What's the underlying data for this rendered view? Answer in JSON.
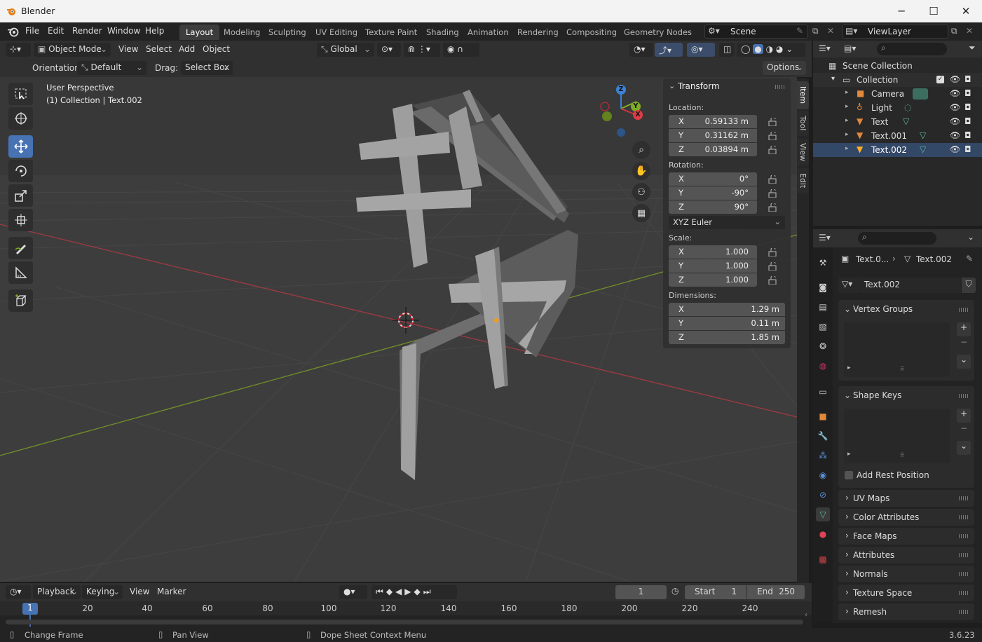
{
  "window": {
    "title": "Blender",
    "minimize": "─",
    "maximize": "☐",
    "close": "✕"
  },
  "menu": {
    "file": "File",
    "edit": "Edit",
    "render": "Render",
    "window": "Window",
    "help": "Help"
  },
  "workspaces": [
    "Layout",
    "Modeling",
    "Sculpting",
    "UV Editing",
    "Texture Paint",
    "Shading",
    "Animation",
    "Rendering",
    "Compositing",
    "Geometry Nodes"
  ],
  "active_workspace": "Layout",
  "scene": {
    "name": "Scene",
    "view_layer": "ViewLayer"
  },
  "viewport_header": {
    "mode": "Object Mode",
    "view": "View",
    "select": "Select",
    "add": "Add",
    "object": "Object",
    "transform_orientation": "Global"
  },
  "tool_settings": {
    "orientation_label": "Orientation:",
    "orientation_value": "Default",
    "drag_label": "Drag:",
    "drag_value": "Select Box",
    "options": "Options"
  },
  "viewport": {
    "perspective": "User Perspective",
    "object_info": "(1) Collection | Text.002",
    "gizmo_axes": {
      "x": "X",
      "y": "Y",
      "z": "Z"
    }
  },
  "n_panel": {
    "title": "Transform",
    "location_label": "Location:",
    "location": [
      {
        "axis": "X",
        "value": "0.59133 m"
      },
      {
        "axis": "Y",
        "value": "0.31162 m"
      },
      {
        "axis": "Z",
        "value": "0.03894 m"
      }
    ],
    "rotation_label": "Rotation:",
    "rotation": [
      {
        "axis": "X",
        "value": "0°"
      },
      {
        "axis": "Y",
        "value": "-90°"
      },
      {
        "axis": "Z",
        "value": "90°"
      }
    ],
    "rotation_mode": "XYZ Euler",
    "scale_label": "Scale:",
    "scale": [
      {
        "axis": "X",
        "value": "1.000"
      },
      {
        "axis": "Y",
        "value": "1.000"
      },
      {
        "axis": "Z",
        "value": "1.000"
      }
    ],
    "dimensions_label": "Dimensions:",
    "dimensions": [
      {
        "axis": "X",
        "value": "1.29 m"
      },
      {
        "axis": "Y",
        "value": "0.11 m"
      },
      {
        "axis": "Z",
        "value": "1.85 m"
      }
    ]
  },
  "side_tabs": [
    "Item",
    "Tool",
    "View",
    "Edit"
  ],
  "outliner": {
    "root": "Scene Collection",
    "collection": "Collection",
    "items": [
      {
        "name": "Camera",
        "icon": "camera-icon"
      },
      {
        "name": "Light",
        "icon": "light-icon"
      },
      {
        "name": "Text",
        "icon": "text-icon"
      },
      {
        "name": "Text.001",
        "icon": "text-icon"
      },
      {
        "name": "Text.002",
        "icon": "text-icon"
      }
    ]
  },
  "properties": {
    "breadcrumb_object": "Text.0...",
    "breadcrumb_data": "Text.002",
    "data_name": "Text.002",
    "panels": {
      "vertex_groups": "Vertex Groups",
      "shape_keys": "Shape Keys",
      "add_rest_position": "Add Rest Position",
      "collapsed": [
        "UV Maps",
        "Color Attributes",
        "Face Maps",
        "Attributes",
        "Normals",
        "Texture Space",
        "Remesh"
      ]
    }
  },
  "timeline": {
    "playback": "Playback",
    "keying": "Keying",
    "view": "View",
    "marker": "Marker",
    "current_frame": "1",
    "start_label": "Start",
    "start": "1",
    "end_label": "End",
    "end": "250",
    "ticks": [
      "20",
      "40",
      "60",
      "80",
      "100",
      "120",
      "140",
      "160",
      "180",
      "200",
      "220",
      "240"
    ],
    "playhead": "1"
  },
  "statusbar": {
    "change_frame": "Change Frame",
    "pan_view": "Pan View",
    "context_menu": "Dope Sheet Context Menu",
    "version": "3.6.23"
  },
  "colors": {
    "accent": "#4772b3",
    "x_axis": "#c8343f",
    "y_axis": "#7eac24",
    "z_axis": "#3b82d4",
    "object_gray": "#8d8d8d"
  }
}
